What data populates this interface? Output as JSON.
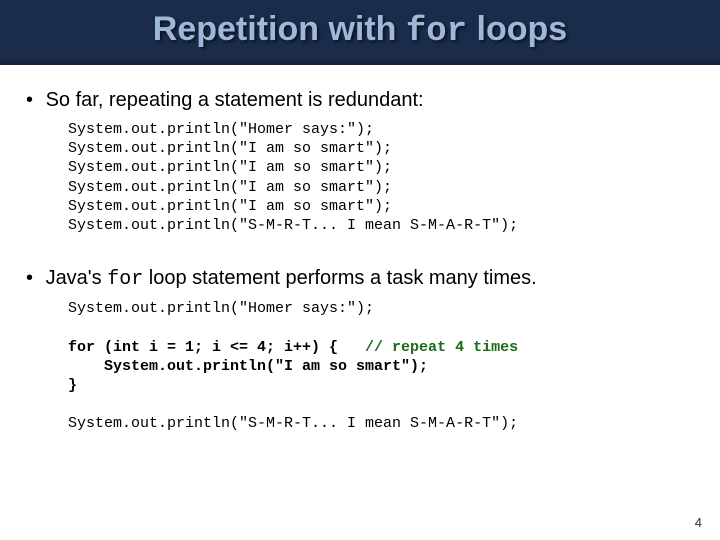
{
  "title": {
    "pre": "Repetition with ",
    "code": "for",
    "post": " loops"
  },
  "bullets": {
    "b1": "So far, repeating a statement is redundant:",
    "b2_pre": "Java's ",
    "b2_code": "for",
    "b2_post": " loop statement performs a task many times."
  },
  "code1": {
    "l1": "System.out.println(\"Homer says:\");",
    "l2": "System.out.println(\"I am so smart\");",
    "l3": "System.out.println(\"I am so smart\");",
    "l4": "System.out.println(\"I am so smart\");",
    "l5": "System.out.println(\"I am so smart\");",
    "l6": "System.out.println(\"S-M-R-T... I mean S-M-A-R-T\");"
  },
  "code2": {
    "l1": "System.out.println(\"Homer says:\");",
    "l2a": "for (int i = 1; i <= 4; i++) {",
    "l2c": "   // repeat 4 times",
    "l3": "    System.out.println(\"I am so smart\");",
    "l4": "}",
    "l5": "System.out.println(\"S-M-R-T... I mean S-M-A-R-T\");"
  },
  "page_number": "4"
}
